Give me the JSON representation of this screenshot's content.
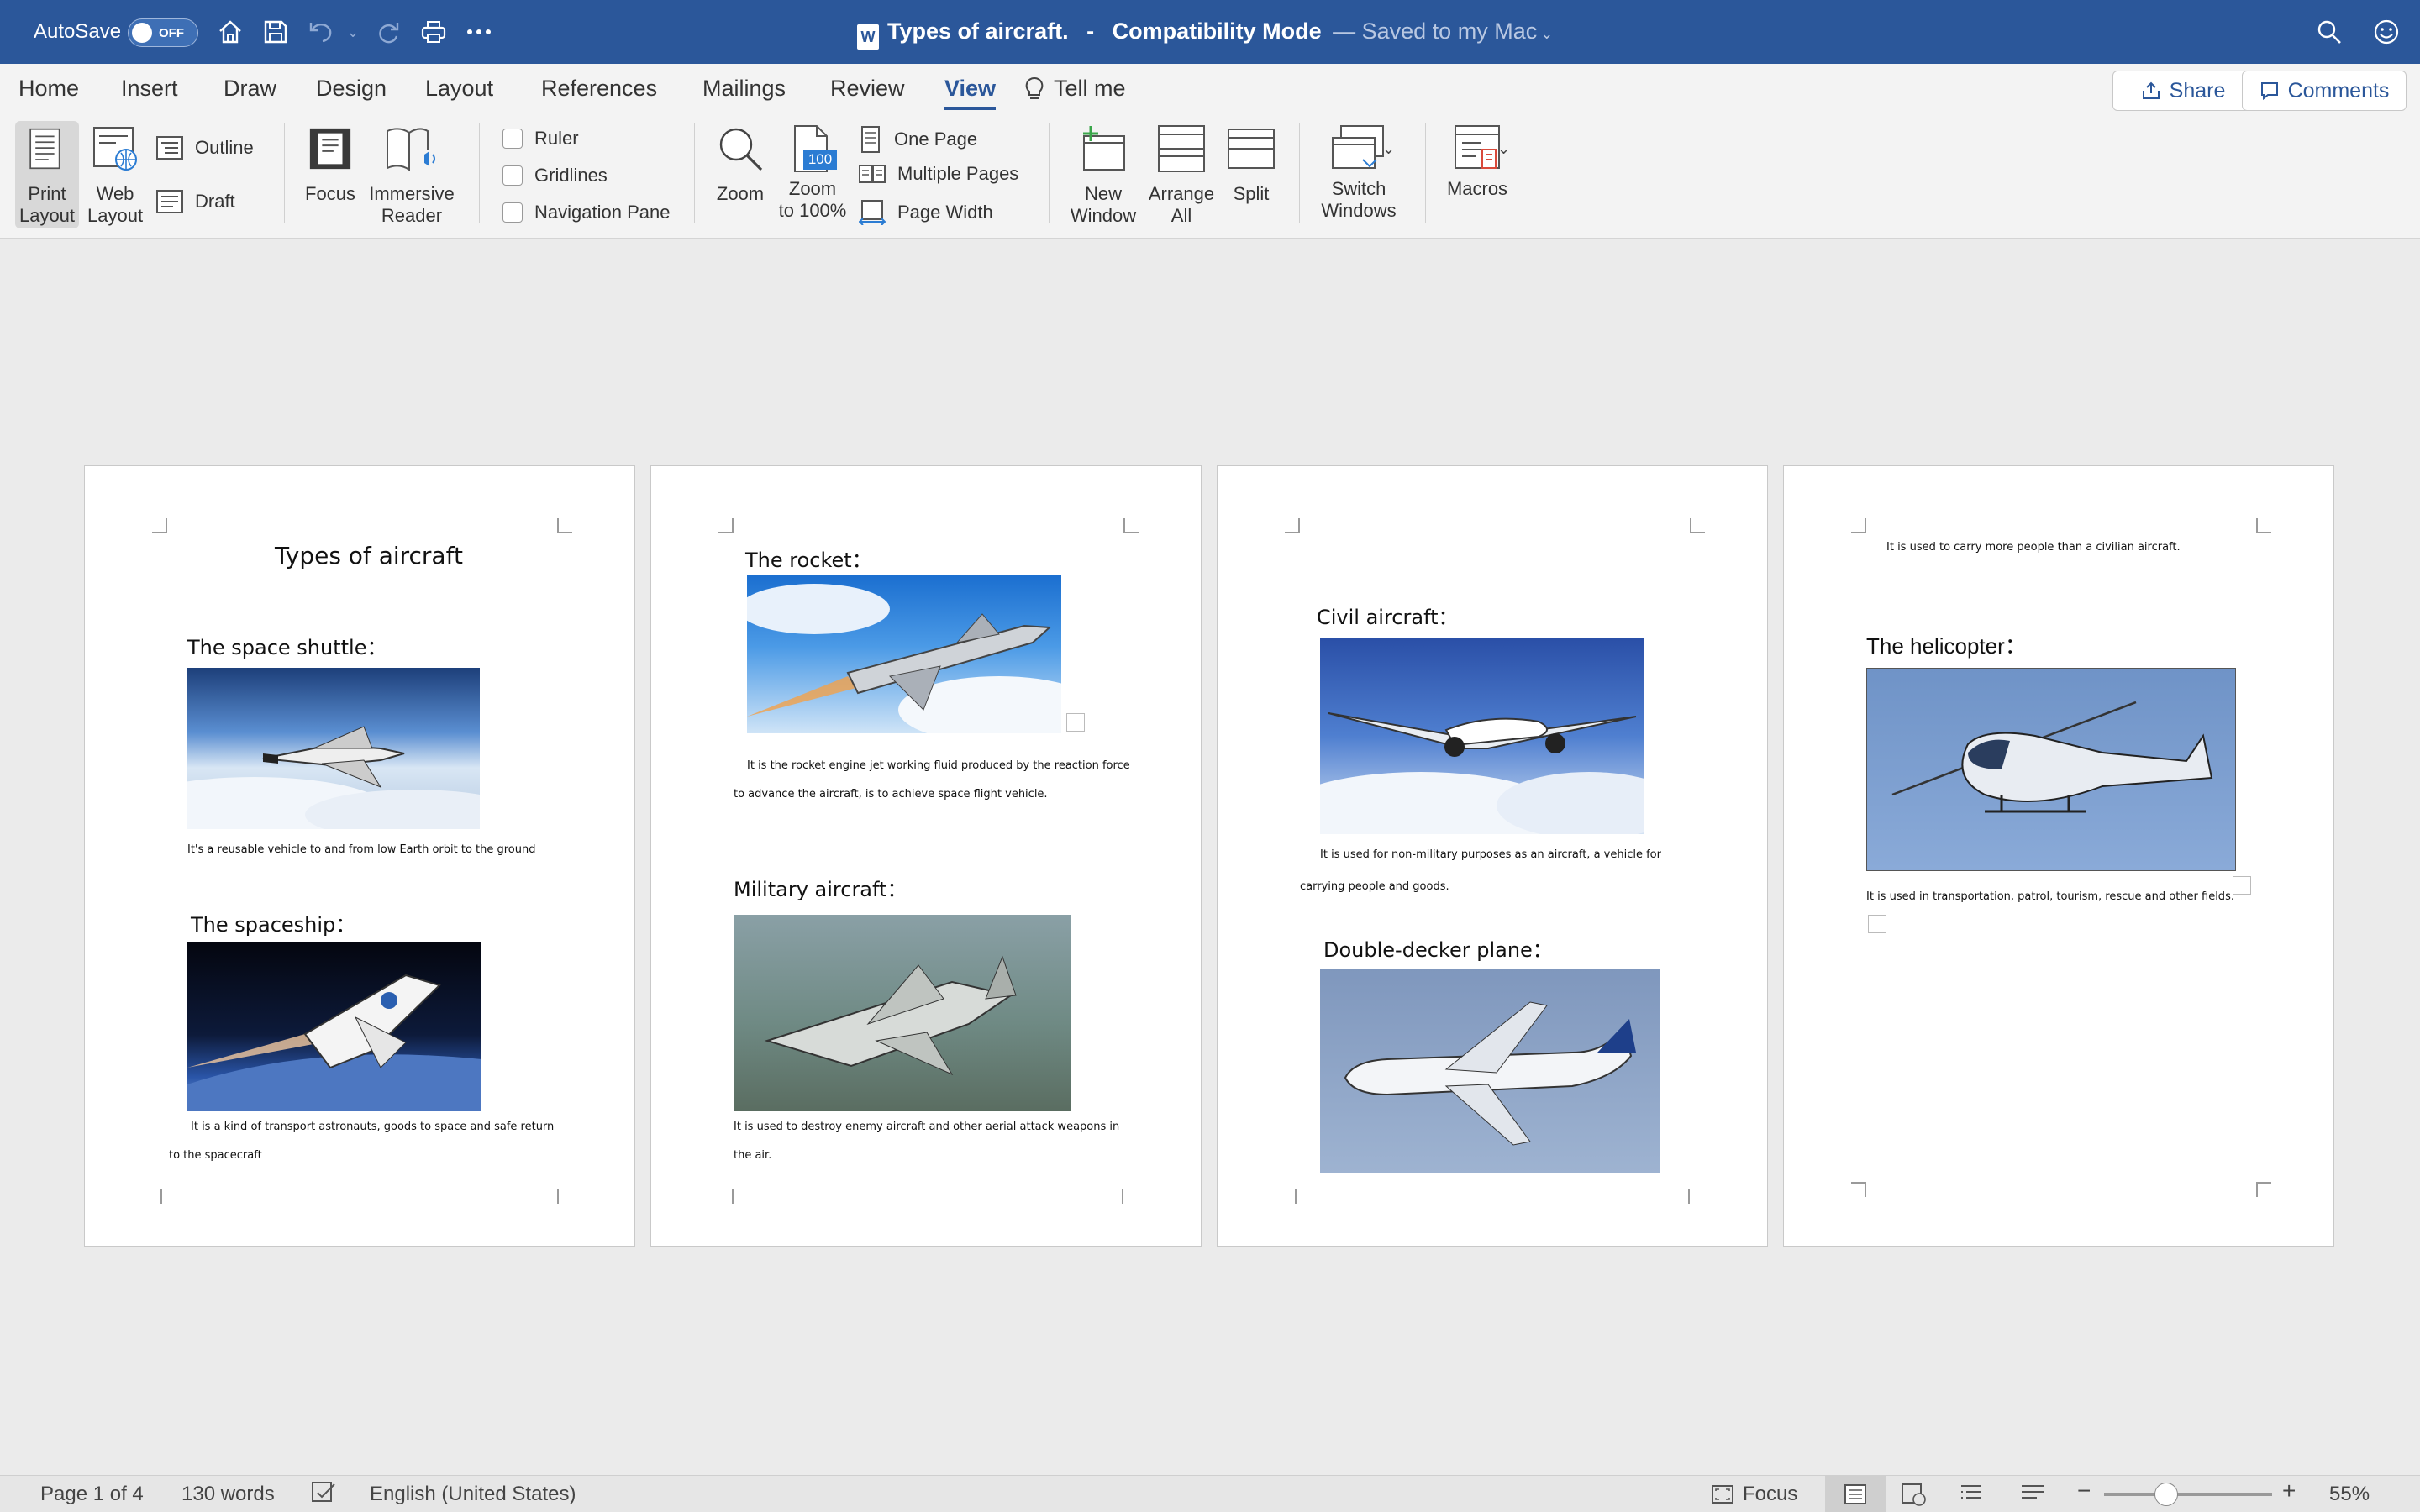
{
  "titlebar": {
    "autosave_label": "AutoSave",
    "autosave_state": "OFF",
    "doc_name": "Types of aircraft.",
    "separator": "-",
    "mode": "Compatibility Mode",
    "save_state": "— Saved to my Mac",
    "word_badge": "W"
  },
  "tabs": [
    "Home",
    "Insert",
    "Draw",
    "Design",
    "Layout",
    "References",
    "Mailings",
    "Review",
    "View"
  ],
  "tell_me": "Tell me",
  "share_label": "Share",
  "comments_label": "Comments",
  "ribbon": {
    "print_layout": [
      "Print",
      "Layout"
    ],
    "web_layout": [
      "Web",
      "Layout"
    ],
    "outline": "Outline",
    "draft": "Draft",
    "focus": "Focus",
    "immersive_reader": [
      "Immersive",
      "Reader"
    ],
    "ruler": "Ruler",
    "gridlines": "Gridlines",
    "navigation_pane": "Navigation Pane",
    "zoom": "Zoom",
    "zoom_100": [
      "Zoom",
      "to 100%"
    ],
    "zoom_100_badge": "100",
    "one_page": "One Page",
    "multiple_pages": "Multiple Pages",
    "page_width": "Page Width",
    "new_window": [
      "New",
      "Window"
    ],
    "arrange_all": [
      "Arrange",
      "All"
    ],
    "split": "Split",
    "switch_windows": [
      "Switch",
      "Windows"
    ],
    "macros": "Macros"
  },
  "pages": {
    "p1": {
      "title": "Types of aircraft",
      "h1": "The space shuttle：",
      "t1": "It's a reusable vehicle to and from low Earth orbit to the ground",
      "h2": "The spaceship：",
      "t2a": "It is a kind of transport astronauts, goods to space and safe return",
      "t2b": "to the spacecraft"
    },
    "p2": {
      "h1": "The rocket：",
      "t1a": "It is the rocket engine jet working fluid produced by the reaction force",
      "t1b": "to advance the aircraft, is to achieve space flight vehicle.",
      "h2": "Military aircraft：",
      "t2a": "It is used to destroy enemy aircraft and other aerial attack weapons in",
      "t2b": "the air."
    },
    "p3": {
      "h1": "Civil aircraft：",
      "t1a": "It is used for non-military purposes as an aircraft, a vehicle for",
      "t1b": "carrying people and goods.",
      "h2": "Double-decker plane："
    },
    "p4": {
      "t0": "It is used to carry more people than a civilian aircraft.",
      "h1": "The helicopter：",
      "t1": "It is used in transportation, patrol, tourism, rescue and other fields."
    }
  },
  "status": {
    "page": "Page 1 of 4",
    "words": "130 words",
    "language": "English (United States)",
    "focus": "Focus",
    "zoom_level": "55%",
    "zoom_slider_fraction": 0.37
  }
}
